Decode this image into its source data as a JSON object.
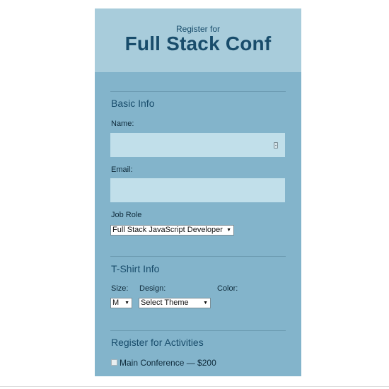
{
  "header": {
    "subtitle": "Register for",
    "title": "Full Stack Conf"
  },
  "basic_info": {
    "heading": "Basic Info",
    "name_label": "Name:",
    "name_value": "",
    "email_label": "Email:",
    "email_value": "",
    "job_role_label": "Job Role",
    "job_role_selected": "Full Stack JavaScript Developer"
  },
  "tshirt_info": {
    "heading": "T-Shirt Info",
    "size_label": "Size:",
    "size_selected": "M",
    "design_label": "Design:",
    "design_selected": "Select Theme",
    "color_label": "Color:"
  },
  "activities": {
    "heading": "Register for Activities",
    "items": [
      {
        "label": "Main Conference — $200",
        "checked": false
      }
    ]
  },
  "icons": {
    "name_field_icon": "autofill-card-icon",
    "dropdown_arrow": "▼"
  }
}
